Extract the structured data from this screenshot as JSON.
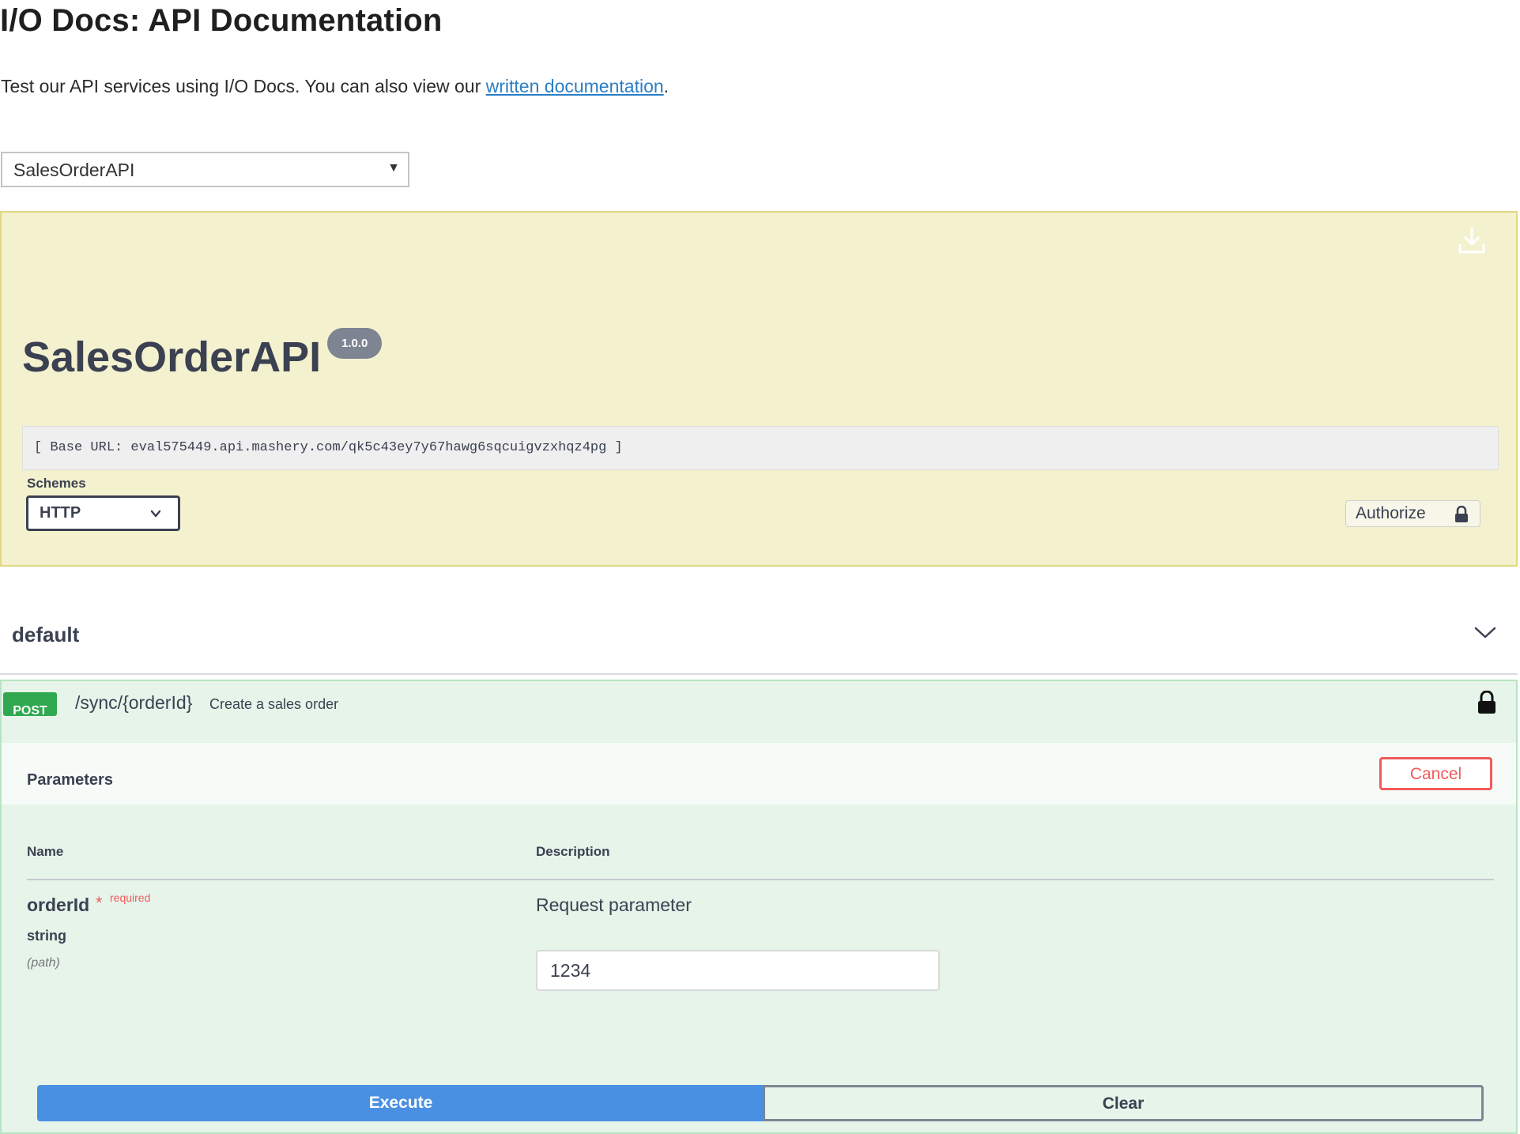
{
  "header": {
    "title": "I/O Docs: API Documentation",
    "intro_prefix": "Test our API services using I/O Docs. You can also view our ",
    "intro_link": "written documentation",
    "intro_suffix": "."
  },
  "api_selector": {
    "selected": "SalesOrderAPI"
  },
  "info": {
    "api_name": "SalesOrderAPI",
    "version": "1.0.0",
    "base_url": "[ Base URL: eval575449.api.mashery.com/qk5c43ey7y67hawg6sqcuigvzxhqz4pg ]",
    "schemes_label": "Schemes",
    "scheme_selected": "HTTP",
    "authorize_label": "Authorize"
  },
  "tag": {
    "title": "default"
  },
  "operation": {
    "method": "POST",
    "path": "/sync/{orderId}",
    "summary": "Create a sales order",
    "parameters_title": "Parameters",
    "cancel_label": "Cancel",
    "col_name": "Name",
    "col_description": "Description",
    "param": {
      "name": "orderId",
      "required_star": "*",
      "required_label": "required",
      "type": "string",
      "location": "(path)",
      "description": "Request parameter",
      "value": "1234"
    },
    "execute_label": "Execute",
    "clear_label": "Clear"
  },
  "colors": {
    "info_bg": "#f4f1cf",
    "post_green": "#2fa84f",
    "op_bg": "#e6f4ea",
    "execute_blue": "#4990e2",
    "cancel_red": "#f15b5b",
    "link_blue": "#2a7ec5"
  },
  "icons": {
    "download": "download-icon",
    "lock": "lock-icon",
    "chevron": "chevron-down-icon"
  }
}
